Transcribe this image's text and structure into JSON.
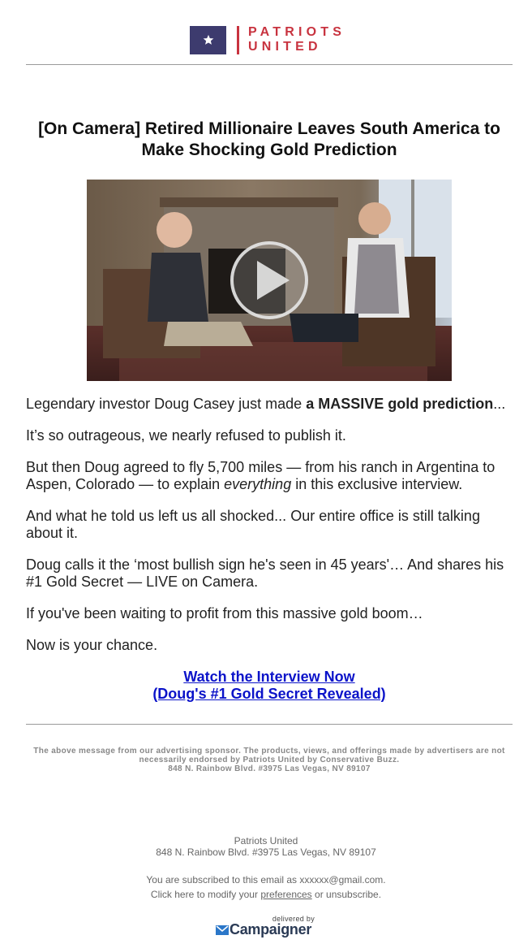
{
  "header": {
    "brand_line1": "PATRIOTS",
    "brand_line2": "UNITED",
    "brand_box_color": "#3d3b6e",
    "brand_text_color": "#c8333f"
  },
  "headline": "[On Camera] Retired Millionaire Leaves South America to Make Shocking Gold Prediction",
  "video": {
    "play_icon": "play-circle-icon"
  },
  "body": {
    "p1_pre": "Legendary investor Doug Casey just made ",
    "p1_bold": "a MASSIVE gold prediction",
    "p1_post": "...",
    "p2": "It’s so outrageous, we nearly refused to publish it.",
    "p3_pre": "But then Doug agreed to fly 5,700 miles — from his ranch in Argentina to Aspen, Colorado — to explain ",
    "p3_em": "everything",
    "p3_post": " in this exclusive interview.",
    "p4": "And what he told us left us all shocked... Our entire office is still talking about it.",
    "p5": "Doug calls it the ‘most bullish sign he's seen in 45 years'… And shares his #1 Gold Secret — LIVE on Camera.",
    "p6": "If you've been waiting to profit from this massive gold boom…",
    "p7": "Now is your chance."
  },
  "cta": {
    "line1": "Watch the Interview Now",
    "line2": "(Doug's #1 Gold Secret Revealed)",
    "link_color": "#0b13c9"
  },
  "disclaimer": {
    "text": "The above message from our advertising sponsor. The products, views, and offerings made by advertisers are not necessarily endorsed by Patriots United by Conservative Buzz.",
    "address": "848 N. Rainbow Blvd. #3975 Las Vegas, NV 89107"
  },
  "footer": {
    "org": "Patriots United",
    "address": "848 N. Rainbow Blvd. #3975 Las Vegas, NV 89107",
    "subscribed": "You are subscribed to this email as xxxxxx@gmail.com.",
    "modify_pre": "Click here to modify your ",
    "preferences_link": "preferences",
    "modify_post": " or unsubscribe."
  },
  "campaigner": {
    "delivered_by": "delivered by",
    "name": "Campaigner"
  }
}
